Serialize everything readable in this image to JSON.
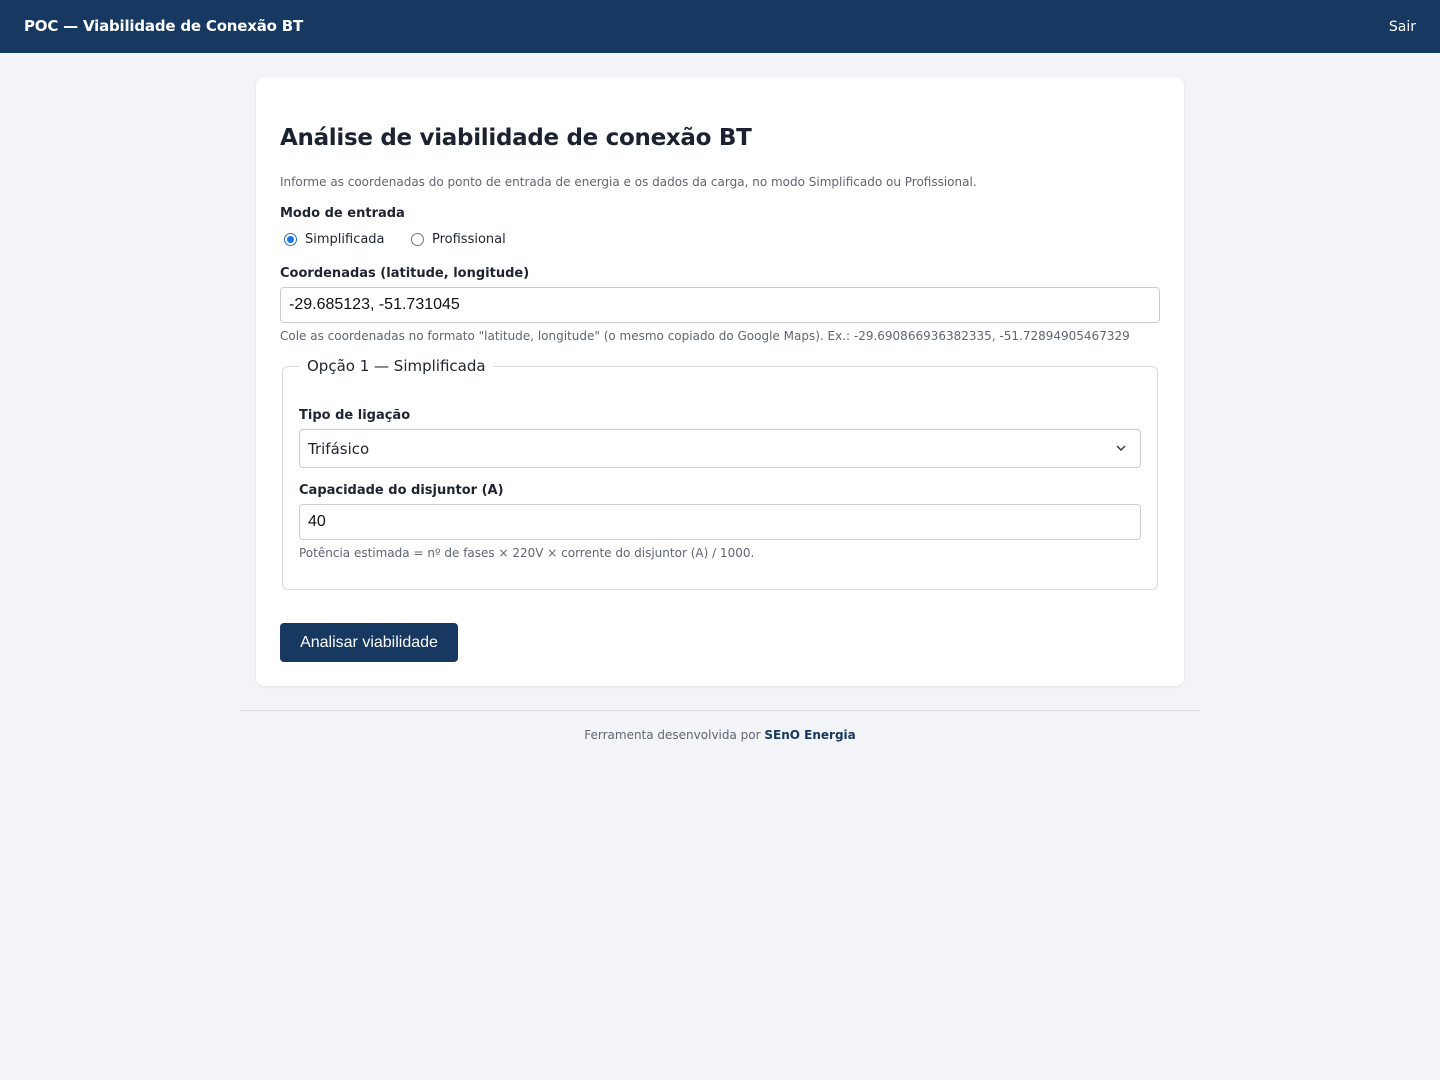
{
  "header": {
    "title": "POC — Viabilidade de Conexão BT",
    "logout_label": "Sair"
  },
  "main": {
    "heading": "Análise de viabilidade de conexão BT",
    "intro": "Informe as coordenadas do ponto de entrada de energia e os dados da carga, no modo Simplificado ou Profissional.",
    "input_mode": {
      "label": "Modo de entrada",
      "options": [
        {
          "label": "Simplificada",
          "checked": true
        },
        {
          "label": "Profissional",
          "checked": false
        }
      ]
    },
    "coordinates": {
      "label": "Coordenadas (latitude, longitude)",
      "value": "-29.685123, -51.731045",
      "help": "Cole as coordenadas no formato \"latitude, longitude\" (o mesmo copiado do Google Maps). Ex.: -29.690866936382335, -51.72894905467329"
    },
    "simplified": {
      "legend": "Opção 1 — Simplificada",
      "connection_type": {
        "label": "Tipo de ligação",
        "selected": "Trifásico",
        "icon": "chevron-down-icon"
      },
      "breaker_capacity": {
        "label": "Capacidade do disjuntor (A)",
        "value": "40",
        "help": "Potência estimada = nº de fases × 220V × corrente do disjuntor (A) / 1000."
      }
    },
    "submit_label": "Analisar viabilidade"
  },
  "footer": {
    "text": "Ferramenta desenvolvida por",
    "brand": "SEnO Energia"
  },
  "colors": {
    "primary": "#173861",
    "background": "#f2f4f7",
    "radio_accent": "#1a73e8"
  }
}
